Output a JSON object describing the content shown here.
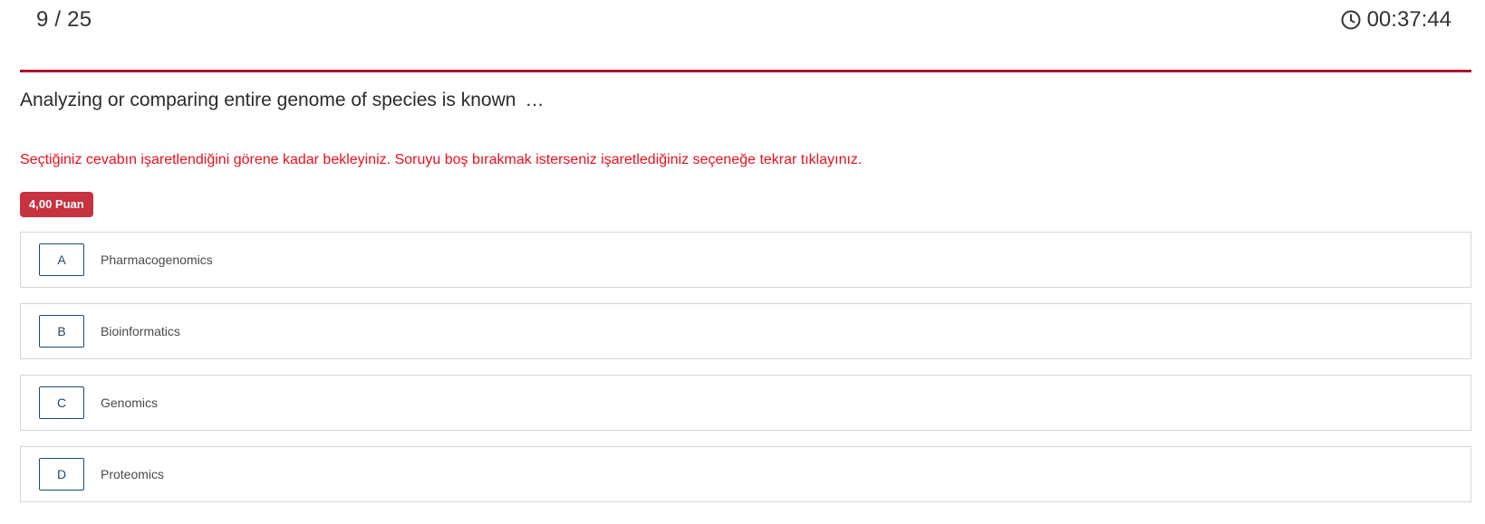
{
  "header": {
    "progress": "9 / 25",
    "timer": "00:37:44",
    "timer_icon": "clock-icon",
    "accent_color": "#b0102e"
  },
  "question": {
    "text": "Analyzing or comparing entire genome of species is known",
    "ellipsis": "…"
  },
  "warning": {
    "text": "Seçtiğiniz cevabın işaretlendiğini görene kadar bekleyiniz. Soruyu boş bırakmak isterseniz işaretlediğiniz seçeneğe tekrar tıklayınız.",
    "color": "#e8101e"
  },
  "points_badge": {
    "label": "4,00 Puan",
    "color": "#c6323f"
  },
  "options": [
    {
      "letter": "A",
      "text": "Pharmacogenomics"
    },
    {
      "letter": "B",
      "text": "Bioinformatics"
    },
    {
      "letter": "C",
      "text": "Genomics"
    },
    {
      "letter": "D",
      "text": "Proteomics"
    }
  ]
}
